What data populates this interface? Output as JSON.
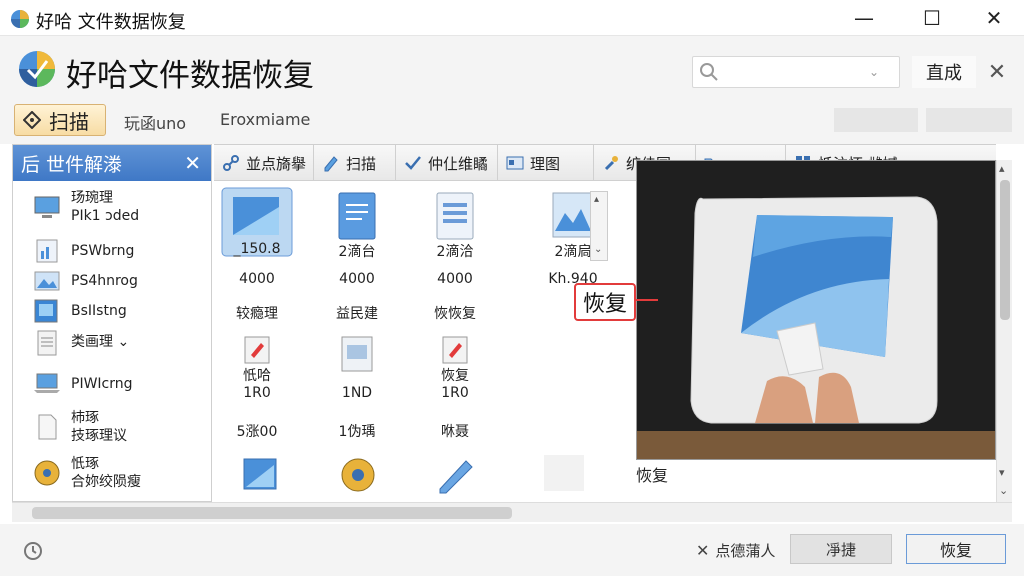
{
  "window": {
    "title": "好哈 文件数据恢复",
    "minimize": "—",
    "maximize": "☐",
    "close": "✕"
  },
  "header": {
    "app_name": "好哈文件数据恢复",
    "search_placeholder": "",
    "search_caret": "⌄",
    "done_label": "直成",
    "close_label": "✕"
  },
  "toolbar": {
    "scan_label": "扫描",
    "link1": "玩函uno",
    "link2": "Eroxmiame"
  },
  "left_panel": {
    "title": "后  世件解漛",
    "close": "✕",
    "items": [
      {
        "line1": "玚琬理",
        "line2": "PIk1 ɔded"
      },
      {
        "line1": "PSWbrng",
        "line2": ""
      },
      {
        "line1": "PS4hnrog",
        "line2": ""
      },
      {
        "line1": "BsIIstng",
        "line2": ""
      },
      {
        "line1": "类画理 ⌄",
        "line2": ""
      },
      {
        "line1": "PIWIcrng",
        "line2": ""
      },
      {
        "line1": "杮琢",
        "line2": "技琢理议"
      },
      {
        "line1": "忯琢",
        "line2": "合妳绞陨瘦"
      }
    ]
  },
  "tabs": [
    {
      "label": "並点旖擧"
    },
    {
      "label": "扫描"
    },
    {
      "label": "仲仩维瞲"
    },
    {
      "label": "理图"
    },
    {
      "label": "纩佳国"
    },
    {
      "label": ""
    },
    {
      "label": "忯注怀 雌媙"
    }
  ],
  "files": [
    {
      "name": "_150.8",
      "size": "4000",
      "label": "较瘾理"
    },
    {
      "name": "2滴台",
      "size": "4000",
      "label": "益民建"
    },
    {
      "name": "2滴洽",
      "size": "4000",
      "label": "恢恢复"
    },
    {
      "name": "2滴扃",
      "size": "Kh.940",
      "label": ""
    },
    {
      "name": "忯哈",
      "size": "1R0",
      "label": "5涨00"
    },
    {
      "name": "",
      "size": "1ND",
      "label": "1伪瑀"
    },
    {
      "name": "恢复",
      "size": "1R0",
      "label": "咻聂"
    }
  ],
  "preview": {
    "callout": "恢复",
    "caption": "恢复"
  },
  "status": {
    "clear_label": "点德蒲人",
    "btn2_label": "凈捷",
    "restore_label": "恢复"
  }
}
